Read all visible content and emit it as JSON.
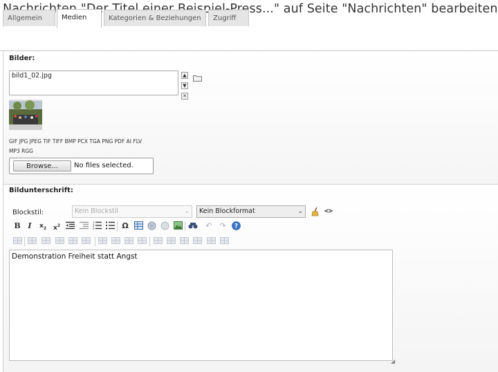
{
  "header": {
    "title": "Nachrichten \"Der Titel einer Beispiel-Press...\" auf Seite \"Nachrichten\" bearbeiten"
  },
  "tabs": [
    {
      "label": "Allgemein",
      "active": false
    },
    {
      "label": "Medien",
      "active": true
    },
    {
      "label": "Kategorien & Beziehungen",
      "active": false
    },
    {
      "label": "Zugriff",
      "active": false
    }
  ],
  "images": {
    "label": "Bilder:",
    "files": [
      "bild1_02.jpg"
    ],
    "allowed_types_line1": "GIF JPG JPEG TIF TIFF BMP PCX TGA PNG PDF AI FLV",
    "allowed_types_line2": "MP3 RGG",
    "browse_label": "Browse...",
    "no_file_label": "No files selected."
  },
  "caption": {
    "label": "Bildunterschrift:",
    "blockstyle_label": "Blockstil:",
    "blockstyle_value": "Kein Blockstil",
    "blockformat_value": "Kein Blockformat",
    "text": "Demonstration Freiheit statt Angst"
  },
  "colors": {
    "accent": "#2a6fc9",
    "tab_active": "#ffffff",
    "tab_inactive": "#e5e5e5"
  }
}
